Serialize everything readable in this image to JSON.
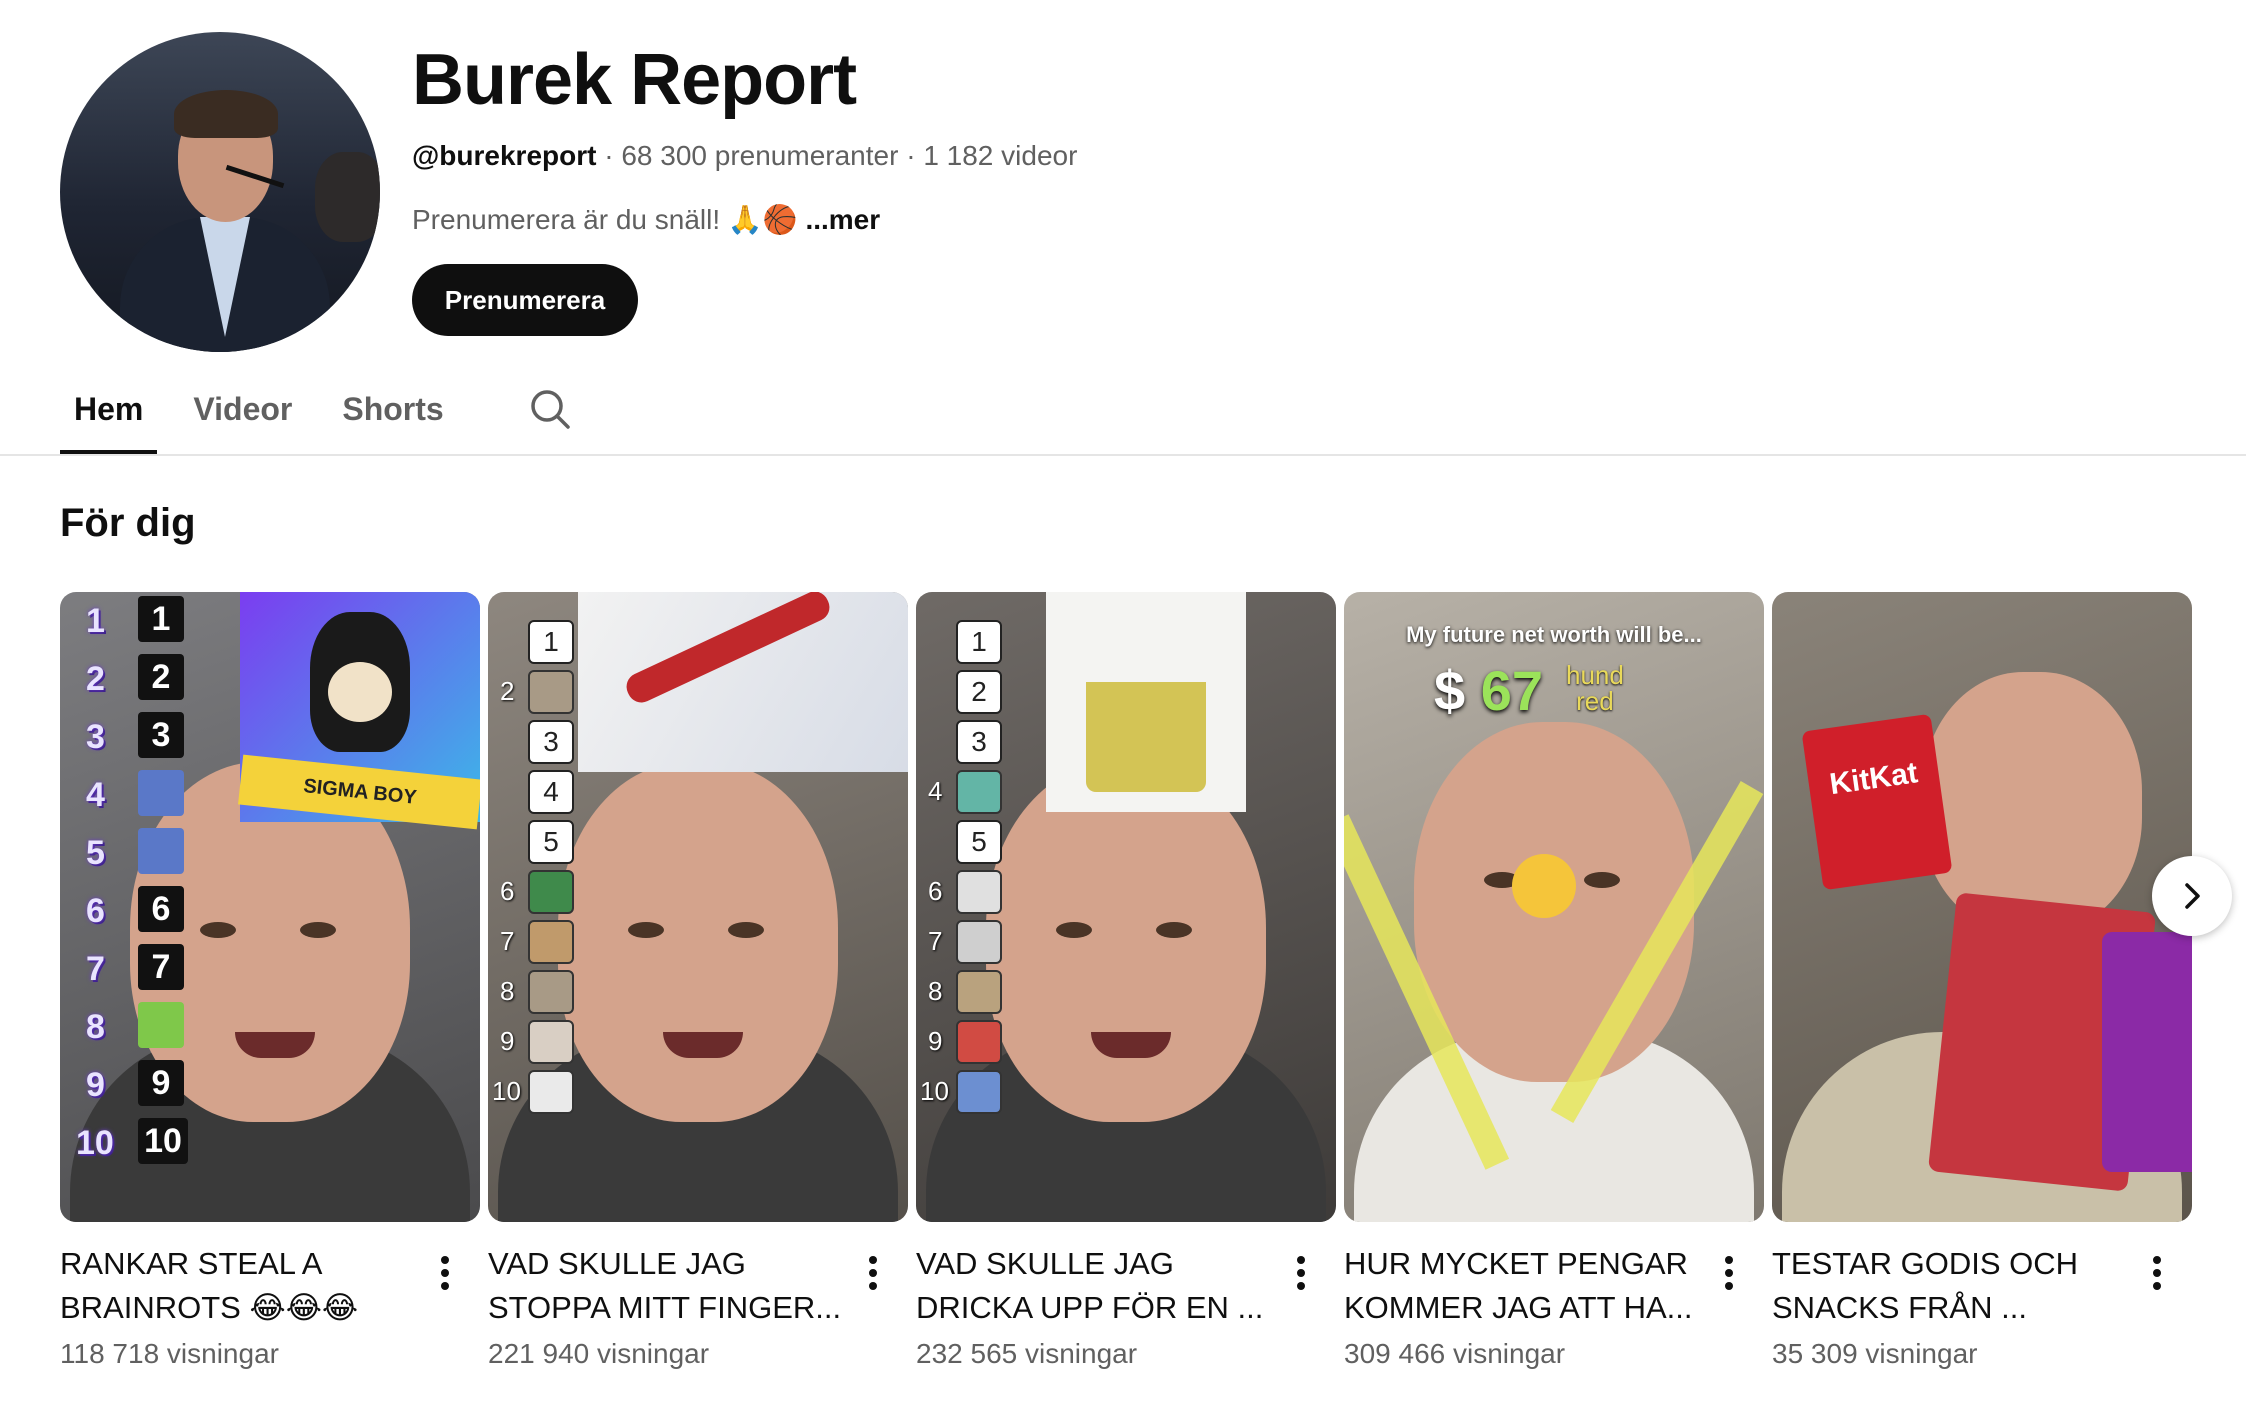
{
  "channel": {
    "name": "Burek Report",
    "handle": "@burekreport",
    "separator": " · ",
    "subscribers": "68 300 prenumeranter",
    "videos": "1 182 videor",
    "description": "Prenumerera är du snäll! 🙏🏀",
    "more_label": "...mer",
    "subscribe_label": "Prenumerera"
  },
  "tabs": [
    {
      "label": "Hem",
      "active": true
    },
    {
      "label": "Videor",
      "active": false
    },
    {
      "label": "Shorts",
      "active": false
    }
  ],
  "tabs_search_icon": "search-icon",
  "section": {
    "title": "För dig"
  },
  "videos": [
    {
      "title": "RANKAR STEAL A BRAINROTS 😂😂😂",
      "views": "118 718 visningar",
      "thumb_texts": {
        "card": "SIGMA BOY",
        "ranks": [
          "1",
          "2",
          "3",
          "4",
          "5",
          "6",
          "7",
          "8",
          "9",
          "10"
        ]
      }
    },
    {
      "title": "VAD SKULLE JAG STOPPA MITT FINGER...",
      "views": "221 940 visningar",
      "thumb_texts": {
        "ranks": [
          "1",
          "2",
          "3",
          "4",
          "5",
          "6",
          "7",
          "8",
          "9",
          "10"
        ]
      }
    },
    {
      "title": "VAD SKULLE JAG DRICKA UPP FÖR EN ...",
      "views": "232 565 visningar",
      "thumb_texts": {
        "ranks": [
          "1",
          "2",
          "3",
          "4",
          "5",
          "6",
          "7",
          "8",
          "9",
          "10"
        ]
      }
    },
    {
      "title": "HUR MYCKET PENGAR KOMMER JAG ATT HA...",
      "views": "309 466 visningar",
      "thumb_texts": {
        "caption": "My future net worth will be...",
        "currency": "$",
        "amount": "67",
        "unit_top": "hund",
        "unit_bottom": "red"
      }
    },
    {
      "title": "TESTAR GODIS OCH SNACKS FRÅN ...",
      "views": "35 309 visningar",
      "thumb_texts": {
        "brand": "KitKat"
      }
    }
  ],
  "icons": {
    "more": "more-vert-icon",
    "next": "chevron-right-icon"
  }
}
